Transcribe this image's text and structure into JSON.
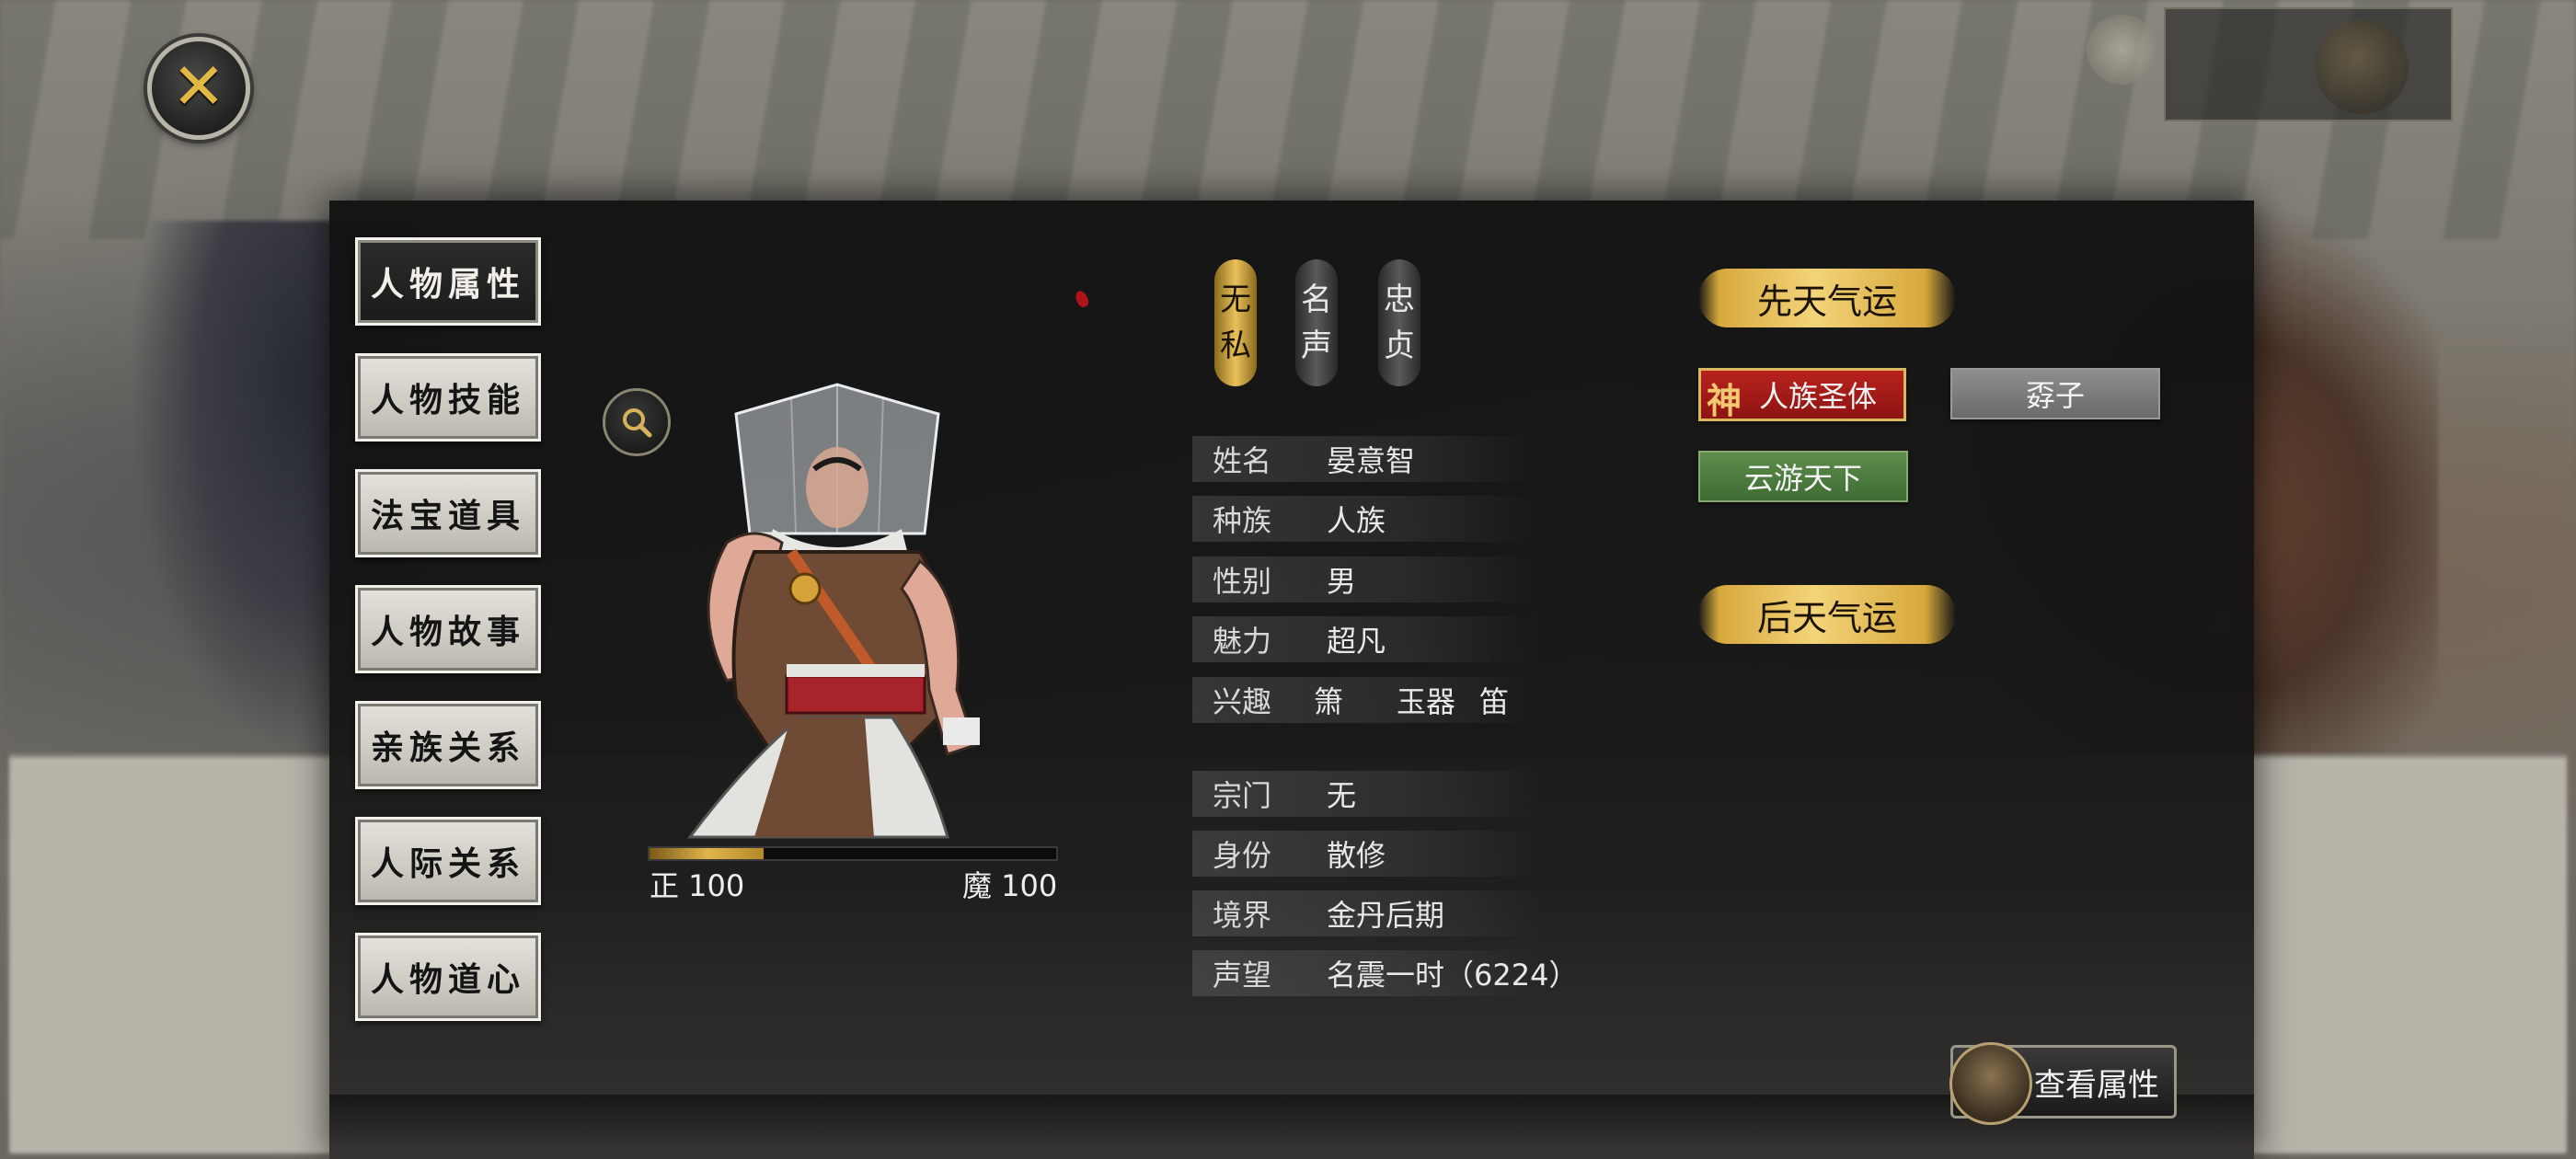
{
  "menu": {
    "items": [
      {
        "label": "人物属性",
        "active": true
      },
      {
        "label": "人物技能",
        "active": false
      },
      {
        "label": "法宝道具",
        "active": false
      },
      {
        "label": "人物故事",
        "active": false
      },
      {
        "label": "亲族关系",
        "active": false
      },
      {
        "label": "人际关系",
        "active": false
      },
      {
        "label": "人物道心",
        "active": false
      }
    ]
  },
  "traits": [
    {
      "chars": [
        "无",
        "私"
      ],
      "style": "gold"
    },
    {
      "chars": [
        "名",
        "声"
      ],
      "style": "gray"
    },
    {
      "chars": [
        "忠",
        "贞"
      ],
      "style": "gray"
    }
  ],
  "info": {
    "name": {
      "label": "姓名",
      "value": "晏意智"
    },
    "race": {
      "label": "种族",
      "value": "人族"
    },
    "gender": {
      "label": "性别",
      "value": "男"
    },
    "charm": {
      "label": "魅力",
      "value": "超凡"
    },
    "hobby": {
      "label": "兴趣",
      "values": [
        "箫",
        "玉器",
        "笛"
      ]
    },
    "sect": {
      "label": "宗门",
      "value": "无"
    },
    "identity": {
      "label": "身份",
      "value": "散修"
    },
    "realm": {
      "label": "境界",
      "value": "金丹后期"
    },
    "fame": {
      "label": "声望",
      "value": "名震一时（6224）"
    }
  },
  "alignment": {
    "righteous_label": "正 100",
    "demonic_label": "魔 100",
    "fill_fraction": 0.28
  },
  "fortune": {
    "innate_title": "先天气运",
    "innate_tags": [
      {
        "prefix": "神",
        "label": "人族圣体",
        "style": "red"
      },
      {
        "label": "孬子",
        "style": "gray"
      },
      {
        "label": "云游天下",
        "style": "green"
      }
    ],
    "acquired_title": "后天气运"
  },
  "actions": {
    "view_attributes": "查看属性"
  },
  "colors": {
    "gold": "#e9c05a",
    "panel": "#161616",
    "red_tag": "#a31b18",
    "green_tag": "#4f7d40"
  },
  "icons": {
    "close": "close-icon",
    "zoom": "magnifier-icon"
  }
}
